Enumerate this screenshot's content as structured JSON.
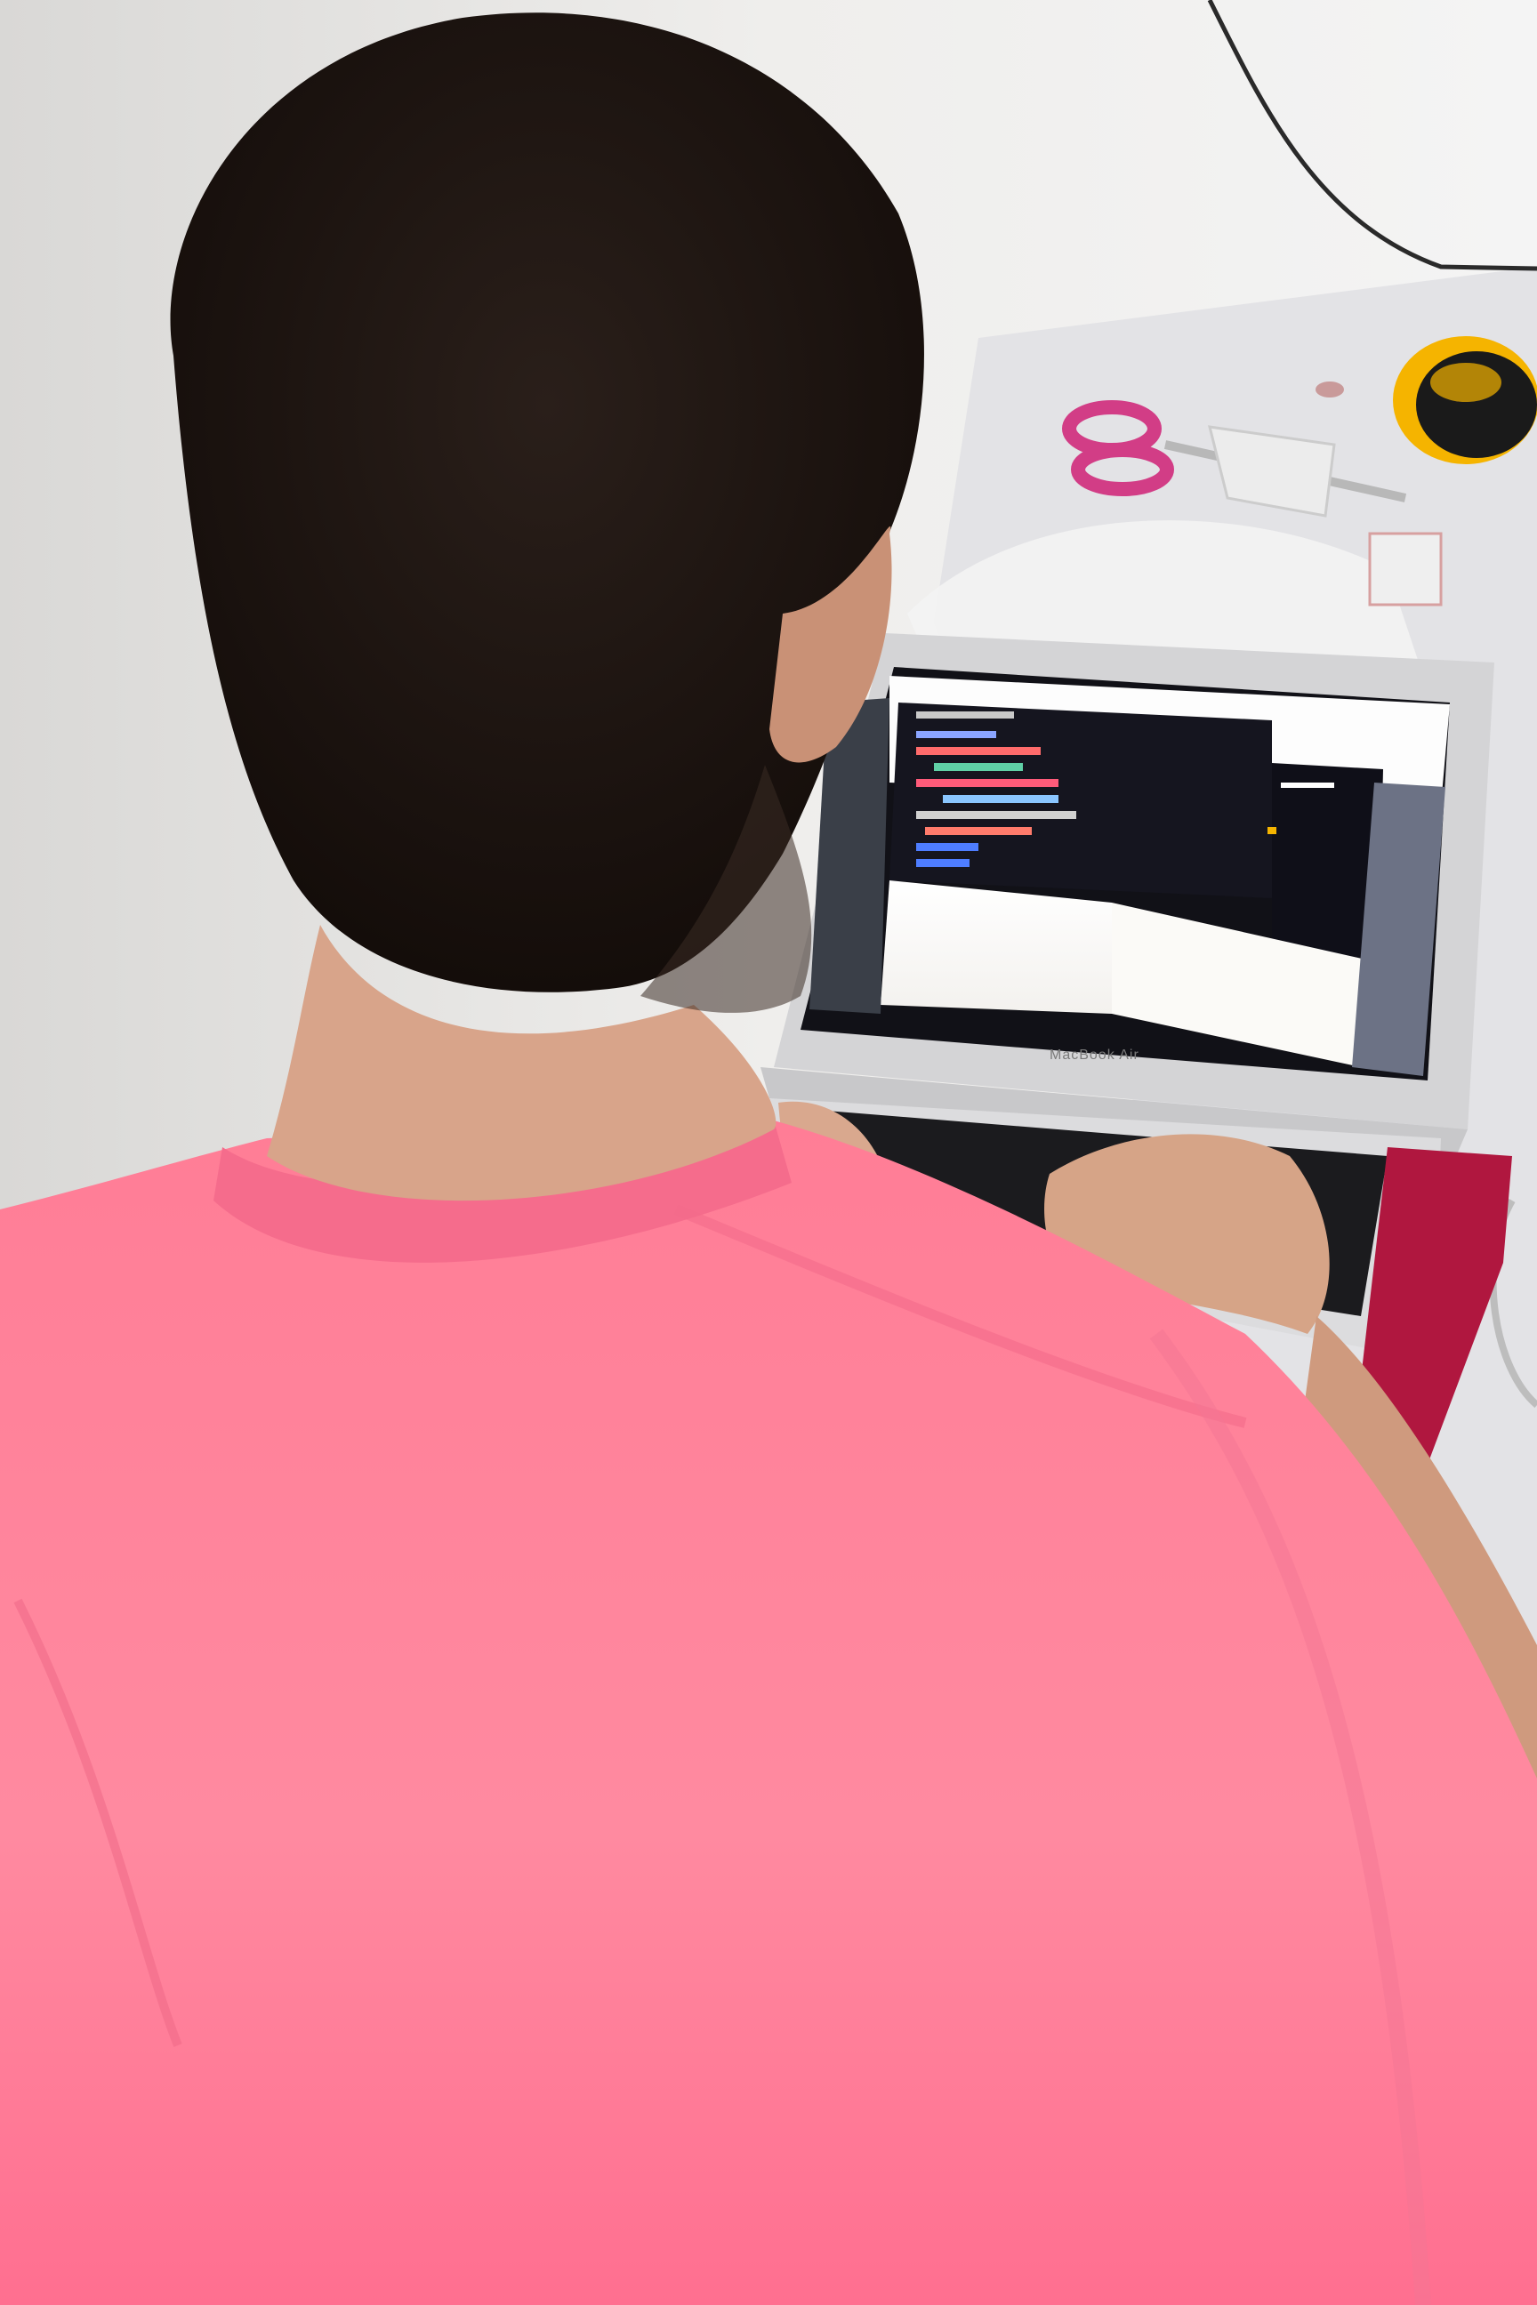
{
  "scene": {
    "laptop_label": "MacBook Air",
    "colors": {
      "wall": "#ebeae8",
      "desk": "#e6e6e8",
      "shirt": "#ff8098",
      "shirt_shadow": "#f05a7e",
      "hair": "#1c1410",
      "skin": "#d9a88e",
      "laptop_body": "#d8d8da",
      "screen_dark": "#171722",
      "screen_light": "#fbfbfb",
      "case_red": "#b0173f",
      "tape_yellow": "#f5b400",
      "scissors_pink": "#d23d86"
    }
  }
}
